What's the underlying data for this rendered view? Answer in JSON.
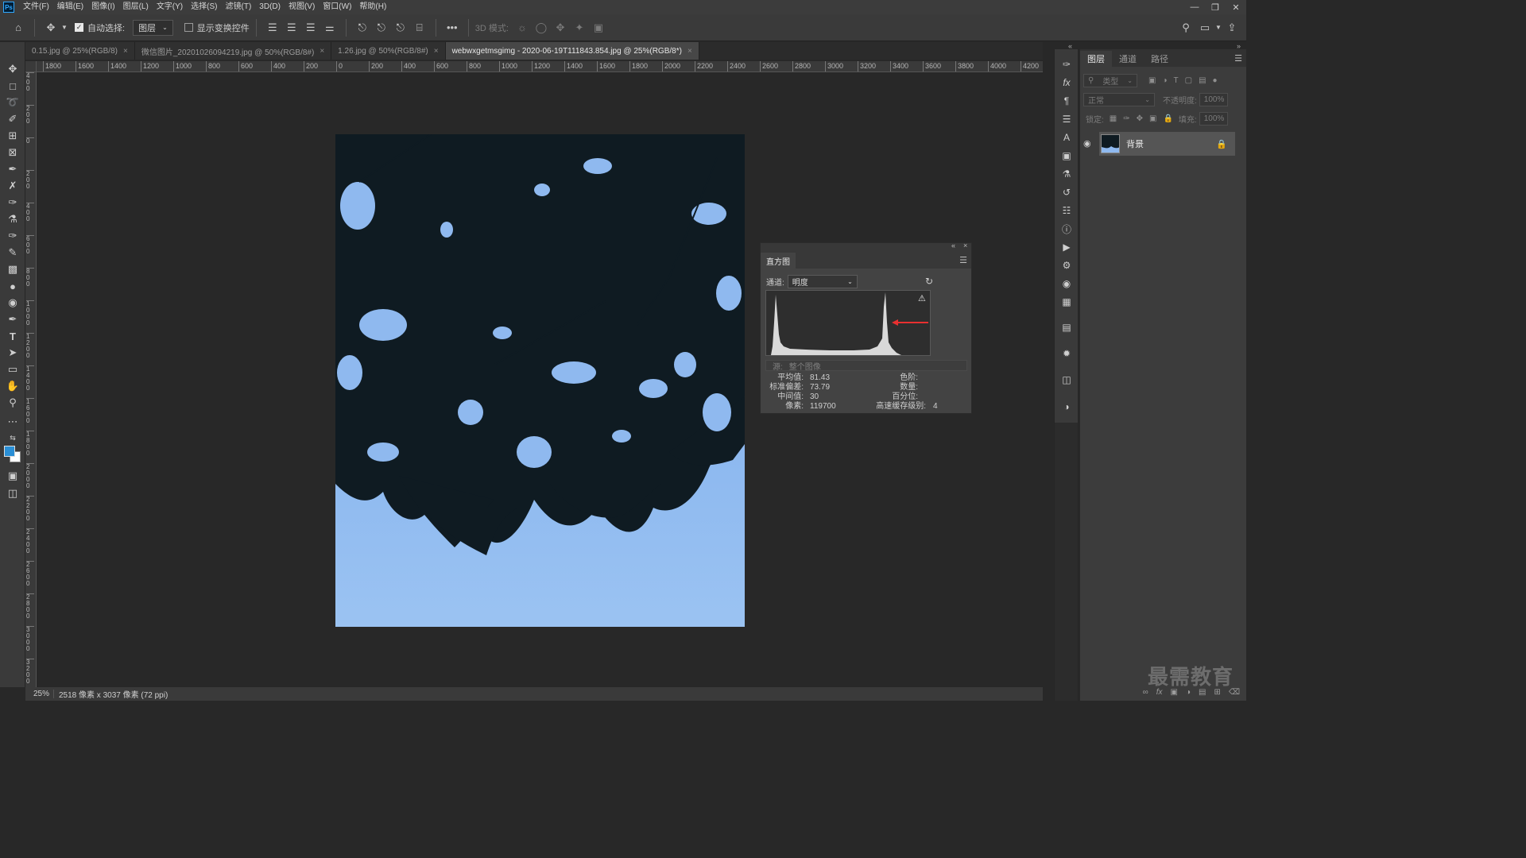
{
  "menubar": {
    "logo": "Ps",
    "items": [
      "文件(F)",
      "编辑(E)",
      "图像(I)",
      "图层(L)",
      "文字(Y)",
      "选择(S)",
      "滤镜(T)",
      "3D(D)",
      "视图(V)",
      "窗口(W)",
      "帮助(H)"
    ],
    "window_controls": [
      "minimize-icon",
      "restore-icon",
      "close-icon"
    ]
  },
  "options": {
    "auto_select_label": "自动选择:",
    "auto_select_checked": true,
    "auto_select_value": "图层",
    "show_transform_label": "显示变换控件",
    "show_transform_checked": false,
    "mode_3d_label": "3D 模式:",
    "more": "•••"
  },
  "tabs": [
    {
      "label": "0.15.jpg @ 25%(RGB/8)",
      "active": false
    },
    {
      "label": "微信图片_20201026094219.jpg @ 50%(RGB/8#)",
      "active": false
    },
    {
      "label": "1.26.jpg @ 50%(RGB/8#)",
      "active": false
    },
    {
      "label": "webwxgetmsgimg - 2020-06-19T111843.854.jpg @ 25%(RGB/8*)",
      "active": true
    }
  ],
  "ruler": {
    "h_ticks": [
      "1800",
      "1600",
      "1400",
      "1200",
      "1000",
      "800",
      "600",
      "400",
      "200",
      "0",
      "200",
      "400",
      "600",
      "800",
      "1000",
      "1200",
      "1400",
      "1600",
      "1800",
      "2000",
      "2200",
      "2400",
      "2600",
      "2800",
      "3000",
      "3200",
      "3400",
      "3600",
      "3800",
      "4000",
      "4200"
    ],
    "v_ticks": [
      "4 0 0",
      "2 0 0",
      "0",
      "2 0 0",
      "4 0 0",
      "6 0 0",
      "8 0 0",
      "1 0 0 0",
      "1 2 0 0",
      "1 4 0 0",
      "1 6 0 0",
      "1 8 0 0",
      "2 0 0 0",
      "2 2 0 0",
      "2 4 0 0",
      "2 6 0 0",
      "2 8 0 0",
      "3 0 0 0",
      "3 2 0 0",
      "3 4 0 0"
    ]
  },
  "status": {
    "zoom": "25%",
    "info": "2518 像素 x 3037 像素 (72 ppi)"
  },
  "histogram": {
    "title": "直方图",
    "channel_label": "通道:",
    "channel_value": "明度",
    "source_label": "源:",
    "source_value": "整个图像",
    "stats_left": [
      {
        "label": "平均值:",
        "value": "81.43"
      },
      {
        "label": "标准偏差:",
        "value": "73.79"
      },
      {
        "label": "中间值:",
        "value": "30"
      },
      {
        "label": "像素:",
        "value": "119700"
      }
    ],
    "stats_right": [
      {
        "label": "色阶:",
        "value": ""
      },
      {
        "label": "数量:",
        "value": ""
      },
      {
        "label": "百分位:",
        "value": ""
      },
      {
        "label": "高速缓存级别:",
        "value": "4"
      }
    ],
    "accent_color": "#e83030"
  },
  "layers": {
    "tabs": [
      "图层",
      "通道",
      "路径"
    ],
    "filter_placeholder": "类型",
    "blend_mode": "正常",
    "opacity_label": "不透明度:",
    "opacity_value": "100%",
    "lock_label": "锁定:",
    "fill_label": "填充:",
    "fill_value": "100%",
    "layer_name": "背景"
  },
  "watermark": "最需教育"
}
